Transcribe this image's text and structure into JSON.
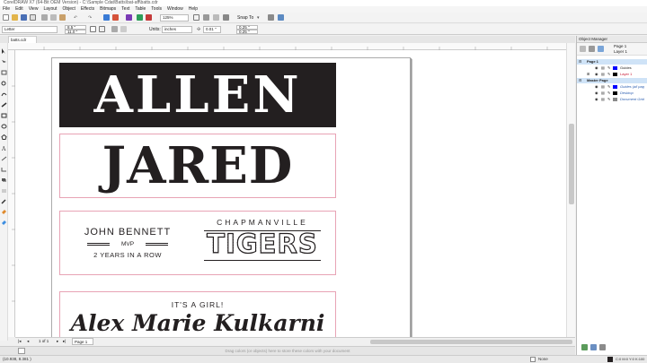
{
  "window": {
    "title": "CorelDRAW X7 (64-Bit OEM Version) - C:\\Sample Cdat\\Batts\\bat-aff\\batts.cdr"
  },
  "menu": [
    "File",
    "Edit",
    "View",
    "Layout",
    "Object",
    "Effects",
    "Bitmaps",
    "Text",
    "Table",
    "Tools",
    "Window",
    "Help"
  ],
  "toolbar": {
    "zoom": "125%",
    "snap_to": "Snap To",
    "page_size": "Letter",
    "width": "8.5 \"",
    "height": "11.0 \"",
    "units_label": "Units:",
    "units": "inches",
    "nudge": "0.01 \"",
    "dup_x": "0.25 \"",
    "dup_y": "0.25 \""
  },
  "document": {
    "tab": "batts.cdr",
    "cards": {
      "card1_name": "ALLEN",
      "card2_name": "JARED",
      "card3_name": "JOHN BENNETT",
      "card3_award": "MVP",
      "card3_detail": "2 YEARS IN A ROW",
      "card3_town": "CHAPMANVILLE",
      "card3_team": "TIGERS",
      "card4_headline": "IT'S A GIRL!",
      "card4_name": "Alex Marie Kulkarni"
    }
  },
  "page_nav": {
    "counter": "1 of 1",
    "page_tab": "Page 1"
  },
  "status": {
    "coords": "(10.938, 8.381 )",
    "hint": "Drag colors (or objects) here to store these colors with your document",
    "fill": "None",
    "outline": "C:0 M:0 Y:0 K:100"
  },
  "object_manager": {
    "title": "Object Manager",
    "page_label": "Page 1",
    "layer_label": "Layer 1",
    "rows": [
      {
        "label": "Page 1",
        "type": "page"
      },
      {
        "label": "Guides",
        "type": "layer"
      },
      {
        "label": "Layer 1",
        "type": "layer-active"
      },
      {
        "label": "Master Page",
        "type": "page"
      },
      {
        "label": "Guides (all pag",
        "type": "layer"
      },
      {
        "label": "Desktop",
        "type": "layer"
      },
      {
        "label": "Document Grid",
        "type": "layer"
      }
    ]
  },
  "colors": {
    "accent": "#e8a3b5",
    "ink": "#231f20",
    "selection": "#cfe3f7"
  }
}
